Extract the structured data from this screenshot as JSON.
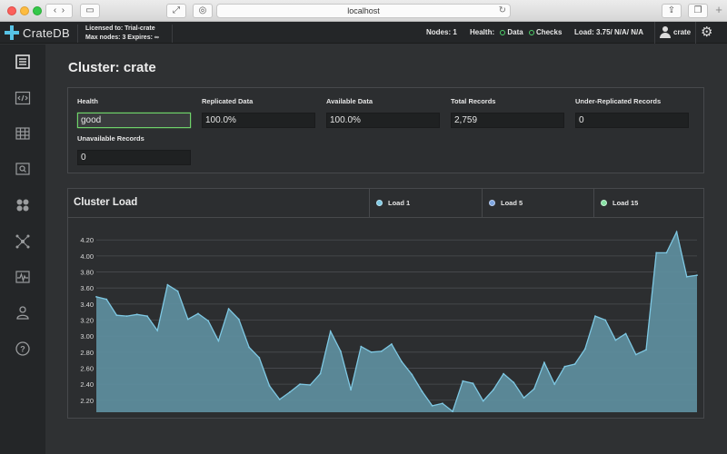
{
  "browser": {
    "url": "localhost"
  },
  "topbar": {
    "logo_text": "CrateDB",
    "license_line1": "Licensed to: Trial-crate",
    "license_line2": "Max nodes: 3 Expires: ∞",
    "nodes": "Nodes: 1",
    "health_label": "Health:",
    "health_data": "Data",
    "health_checks": "Checks",
    "load": "Load: 3.75/ N/A/ N/A",
    "user": "crate",
    "health_color": "#4fcf6b"
  },
  "sidebar": {
    "items": [
      {
        "icon": "overview-icon"
      },
      {
        "icon": "console-icon"
      },
      {
        "icon": "tables-icon"
      },
      {
        "icon": "views-icon"
      },
      {
        "icon": "shards-icon"
      },
      {
        "icon": "cluster-icon"
      },
      {
        "icon": "monitoring-icon"
      },
      {
        "icon": "users-icon"
      },
      {
        "icon": "help-icon"
      }
    ]
  },
  "page": {
    "title": "Cluster: crate"
  },
  "stats": {
    "health_label": "Health",
    "health_value": "good",
    "replicated_label": "Replicated Data",
    "replicated_value": "100.0%",
    "available_label": "Available Data",
    "available_value": "100.0%",
    "records_label": "Total Records",
    "records_value": "2,759",
    "under_replicated_label": "Under-Replicated Records",
    "under_replicated_value": "0",
    "unavailable_label": "Unavailable Records",
    "unavailable_value": "0"
  },
  "chart_panel": {
    "title": "Cluster Load",
    "legend": [
      {
        "label": "Load 1",
        "color": "#7ec8e3"
      },
      {
        "label": "Load 5",
        "color": "#7ea6e0"
      },
      {
        "label": "Load 15",
        "color": "#86e0a3"
      }
    ]
  },
  "chart_data": {
    "type": "area",
    "title": "",
    "xlabel": "",
    "ylabel": "",
    "ylim": [
      2.05,
      4.35
    ],
    "yticks": [
      "4.20",
      "4.00",
      "3.80",
      "3.60",
      "3.40",
      "3.20",
      "3.00",
      "2.80",
      "2.60",
      "2.40",
      "2.20"
    ],
    "grid": true,
    "series": [
      {
        "name": "Load 1",
        "color": "#7ec8e3",
        "values": [
          3.49,
          3.46,
          3.26,
          3.25,
          3.27,
          3.25,
          3.07,
          3.64,
          3.56,
          3.21,
          3.28,
          3.19,
          2.94,
          3.34,
          3.21,
          2.86,
          2.73,
          2.38,
          2.21,
          2.3,
          2.4,
          2.39,
          2.53,
          3.06,
          2.81,
          2.33,
          2.87,
          2.8,
          2.81,
          2.9,
          2.68,
          2.52,
          2.31,
          2.13,
          2.16,
          2.06,
          2.44,
          2.41,
          2.19,
          2.33,
          2.53,
          2.42,
          2.23,
          2.34,
          2.67,
          2.4,
          2.62,
          2.65,
          2.84,
          3.25,
          3.2,
          2.95,
          3.03,
          2.77,
          2.83,
          4.04,
          4.04,
          4.3,
          3.74,
          3.76
        ]
      }
    ]
  }
}
